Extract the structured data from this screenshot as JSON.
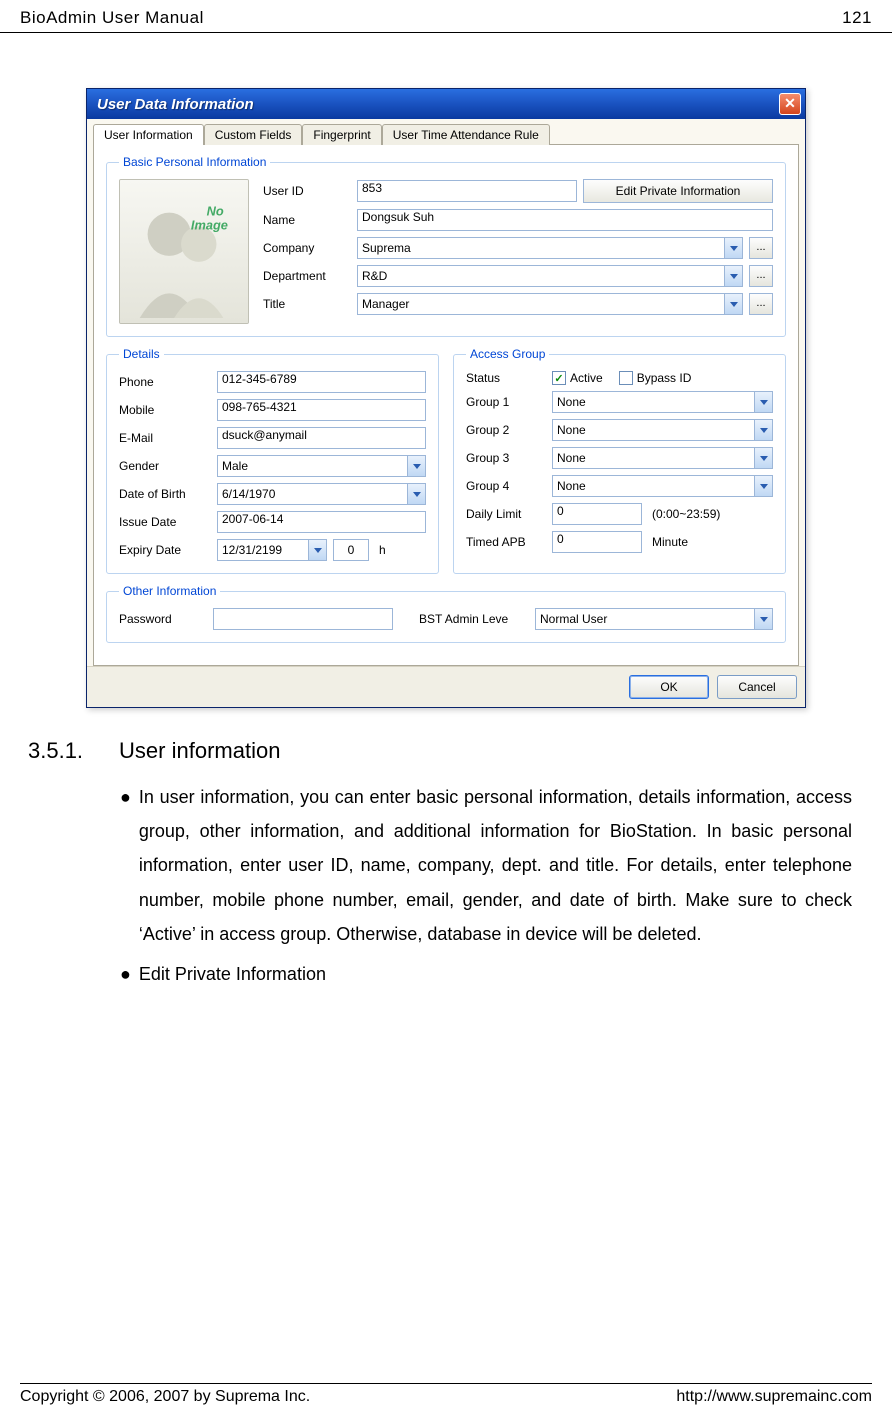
{
  "header": {
    "title": "BioAdmin User Manual",
    "page": "121"
  },
  "footer": {
    "copyright": "Copyright © 2006, 2007 by Suprema Inc.",
    "url": "http://www.supremainc.com"
  },
  "dialog": {
    "title": "User Data Information",
    "tabs": [
      "User Information",
      "Custom Fields",
      "Fingerprint",
      "User Time Attendance Rule"
    ],
    "bpi": {
      "legend": "Basic Personal Information",
      "no_image": "No Image",
      "labels": {
        "user_id": "User ID",
        "name": "Name",
        "company": "Company",
        "department": "Department",
        "title": "Title"
      },
      "values": {
        "user_id": "853",
        "name": "Dongsuk Suh",
        "company": "Suprema",
        "department": "R&D",
        "title": "Manager"
      },
      "edit_btn": "Edit Private Information",
      "browse": "..."
    },
    "details": {
      "legend": "Details",
      "labels": {
        "phone": "Phone",
        "mobile": "Mobile",
        "email": "E-Mail",
        "gender": "Gender",
        "dob": "Date of Birth",
        "issue": "Issue Date",
        "expiry": "Expiry Date"
      },
      "values": {
        "phone": "012-345-6789",
        "mobile": "098-765-4321",
        "email": "dsuck@anymail",
        "gender": "Male",
        "dob": " 6/14/1970",
        "issue": "2007-06-14",
        "expiry": "12/31/2199",
        "expiry_h": "0",
        "expiry_unit": "h"
      }
    },
    "access": {
      "legend": "Access Group",
      "labels": {
        "status": "Status",
        "g1": "Group 1",
        "g2": "Group 2",
        "g3": "Group 3",
        "g4": "Group 4",
        "daily": "Daily Limit",
        "apb": "Timed APB"
      },
      "values": {
        "active": "Active",
        "bypass": "Bypass ID",
        "g1": "None",
        "g2": "None",
        "g3": "None",
        "g4": "None",
        "daily": "0",
        "daily_hint": "(0:00~23:59)",
        "apb": "0",
        "apb_unit": "Minute"
      }
    },
    "other": {
      "legend": "Other Information",
      "labels": {
        "password": "Password",
        "admin": "BST Admin Leve"
      },
      "values": {
        "password": "",
        "admin": "Normal User"
      }
    },
    "buttons": {
      "ok": "OK",
      "cancel": "Cancel"
    }
  },
  "section": {
    "number": "3.5.1.",
    "title": "User information",
    "bullet1": "In user information, you can enter basic personal information, details information, access group, other information, and additional information for BioStation. In basic personal information, enter user ID, name, company, dept. and title. For details, enter telephone number, mobile phone number, email, gender, and date of birth. Make sure to check ‘Active’ in access group. Otherwise, database in device will be deleted.",
    "bullet2": "Edit Private Information"
  }
}
